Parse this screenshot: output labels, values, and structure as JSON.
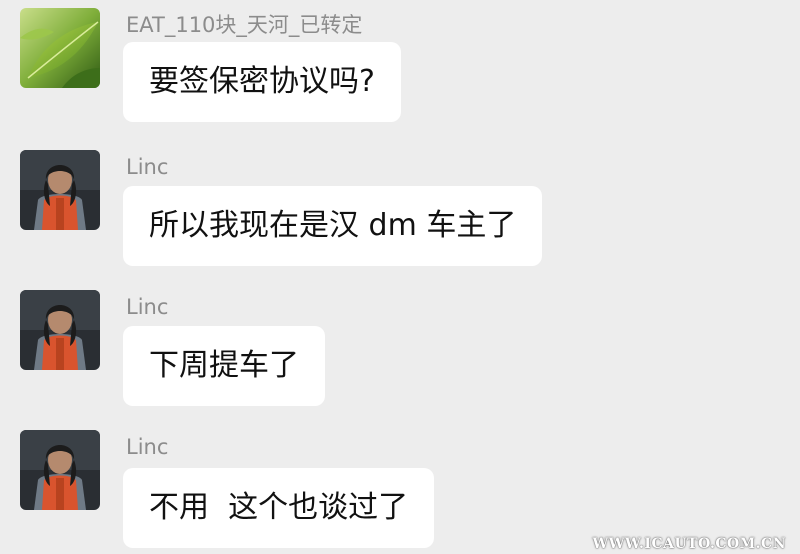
{
  "messages": [
    {
      "sender": "EAT_110块_天河_已转定",
      "text": "要签保密协议吗?",
      "avatar_icon": "green-leaf-avatar-icon"
    },
    {
      "sender": "Linc",
      "text": "所以我现在是汉 dm 车主了",
      "avatar_icon": "person-orange-vest-avatar-icon"
    },
    {
      "sender": "Linc",
      "text": "下周提车了",
      "avatar_icon": "person-orange-vest-avatar-icon"
    },
    {
      "sender": "Linc",
      "text": "不用  这个也谈过了",
      "avatar_icon": "person-orange-vest-avatar-icon"
    }
  ],
  "watermark": "WWW.ICAUTO.COM.CN",
  "colors": {
    "background": "#ededed",
    "bubble": "#ffffff",
    "sender_text": "#8c8c8c",
    "message_text": "#111111"
  }
}
